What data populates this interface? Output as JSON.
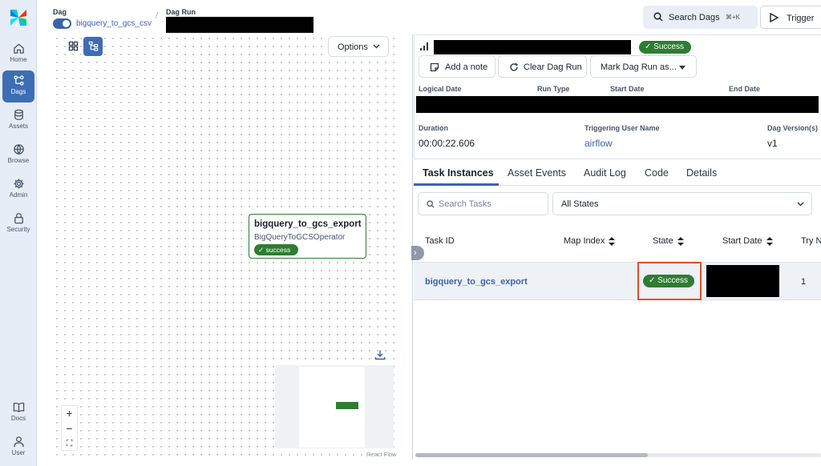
{
  "sidebar": {
    "logo": "airflow-pinwheel-logo",
    "items": [
      {
        "label": "Home",
        "icon": "home-icon"
      },
      {
        "label": "Dags",
        "icon": "dags-icon",
        "active": true
      },
      {
        "label": "Assets",
        "icon": "database-icon"
      },
      {
        "label": "Browse",
        "icon": "globe-icon"
      },
      {
        "label": "Admin",
        "icon": "gear-icon"
      },
      {
        "label": "Security",
        "icon": "lock-icon"
      },
      {
        "label": "Docs",
        "icon": "book-icon"
      },
      {
        "label": "User",
        "icon": "user-icon"
      }
    ]
  },
  "breadcrumb": {
    "dag_label": "Dag",
    "dag_name": "bigquery_to_gcs_csv",
    "dag_run_label": "Dag Run",
    "dag_run_value": "[redacted]"
  },
  "header": {
    "search_label": "Search Dags",
    "search_shortcut": "⌘+K",
    "trigger_label": "Trigger"
  },
  "graph": {
    "options_label": "Options",
    "node": {
      "task_id": "bigquery_to_gcs_export",
      "operator": "BigQueryToGCSOperator",
      "state": "success"
    },
    "zoom_in": "+",
    "zoom_out": "−",
    "fit_view": "⛶",
    "attribution": "React Flow"
  },
  "run": {
    "state": "Success",
    "actions": {
      "add_note": "Add a note",
      "clear": "Clear Dag Run",
      "mark": "Mark Dag Run as..."
    },
    "meta_labels": {
      "logical_date": "Logical Date",
      "run_type": "Run Type",
      "start_date": "Start Date",
      "end_date": "End Date",
      "duration": "Duration",
      "triggering_user": "Triggering User Name",
      "dag_version": "Dag Version(s)"
    },
    "duration": "00:00:22.606",
    "triggering_user": "airflow",
    "dag_version": "v1"
  },
  "tabs": [
    "Task Instances",
    "Asset Events",
    "Audit Log",
    "Code",
    "Details"
  ],
  "task_instances": {
    "search_placeholder": "Search Tasks",
    "state_filter": "All States",
    "columns": [
      "Task ID",
      "Map Index",
      "State",
      "Start Date",
      "Try N"
    ],
    "rows": [
      {
        "task_id": "bigquery_to_gcs_export",
        "state": "Success",
        "try_number": "1"
      }
    ]
  },
  "colors": {
    "accent": "#3b63b0",
    "success": "#2e7d32",
    "highlight": "#e04f2b"
  }
}
